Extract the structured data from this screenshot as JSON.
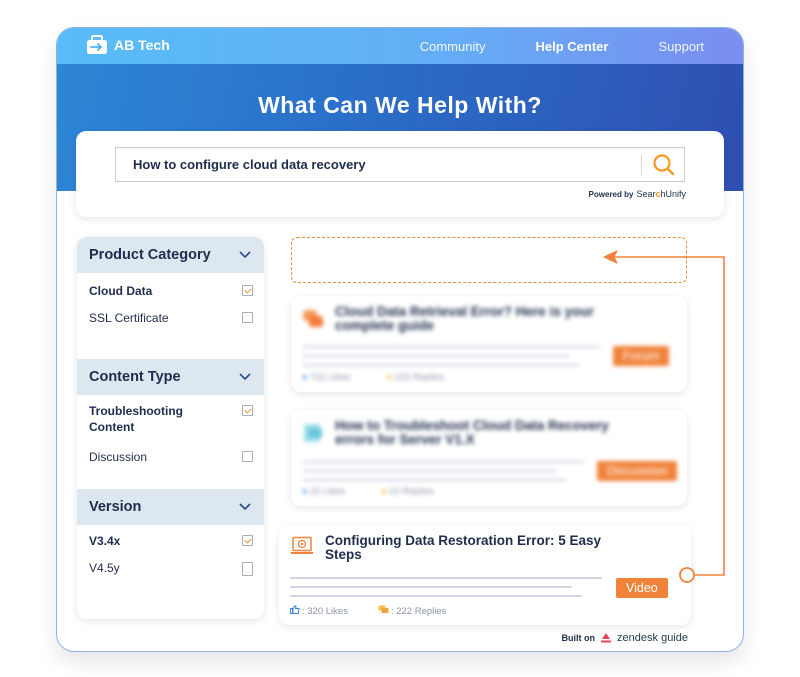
{
  "header": {
    "brand": "AB Tech",
    "logo_icon": "briefcase-arrow-icon",
    "nav": [
      {
        "label": "Community",
        "active": false
      },
      {
        "label": "Help Center",
        "active": true
      },
      {
        "label": "Support",
        "active": false
      }
    ]
  },
  "hero": {
    "title": "What Can We Help With?"
  },
  "search": {
    "value": "How to configure cloud data recovery",
    "icon": "search-icon",
    "powered_by_label": "Powered by",
    "powered_by_brand_prefix": "Sear",
    "powered_by_brand_c": "c",
    "powered_by_brand_suffix": "hUnify"
  },
  "filters": [
    {
      "title": "Product Category",
      "options": [
        {
          "label": "Cloud Data",
          "checked": true
        },
        {
          "label": "SSL Certificate",
          "checked": false
        }
      ]
    },
    {
      "title": "Content Type",
      "options": [
        {
          "label": "Troubleshooting Content",
          "checked": true
        },
        {
          "label": "Discussion",
          "checked": false
        }
      ]
    },
    {
      "title": "Version",
      "options": [
        {
          "label": "V3.4x",
          "checked": true
        },
        {
          "label": "V4.5y",
          "checked": false
        }
      ]
    }
  ],
  "results": [
    {
      "title": "Cloud Data Retrieval Error? Here is your complete guide",
      "tag": "Forum",
      "likes": "722 Likes",
      "replies": "123 Replies",
      "icon": "forum-icon",
      "blurred": true
    },
    {
      "title": "How to Troubleshoot Cloud Data Recovery errors for Server V1.X",
      "tag": "Discussion",
      "likes": "22 Likes",
      "replies": "13 Replies",
      "icon": "document-icon",
      "blurred": true
    },
    {
      "title": "Configuring Data Restoration Error: 5 Easy Steps",
      "tag": "Video",
      "likes": ": 320 Likes",
      "replies": ": 222 Replies",
      "icon": "video-laptop-icon",
      "blurred": false
    }
  ],
  "footer": {
    "built_on_label": "Built on",
    "platform": "zendesk guide"
  },
  "colors": {
    "accent": "#f0823a",
    "primary_dark": "#1f2d4d",
    "hero_blue": "#2a6ec8",
    "topbar_blue": "#58bdf9",
    "facet_header_bg": "#dde7f0"
  }
}
